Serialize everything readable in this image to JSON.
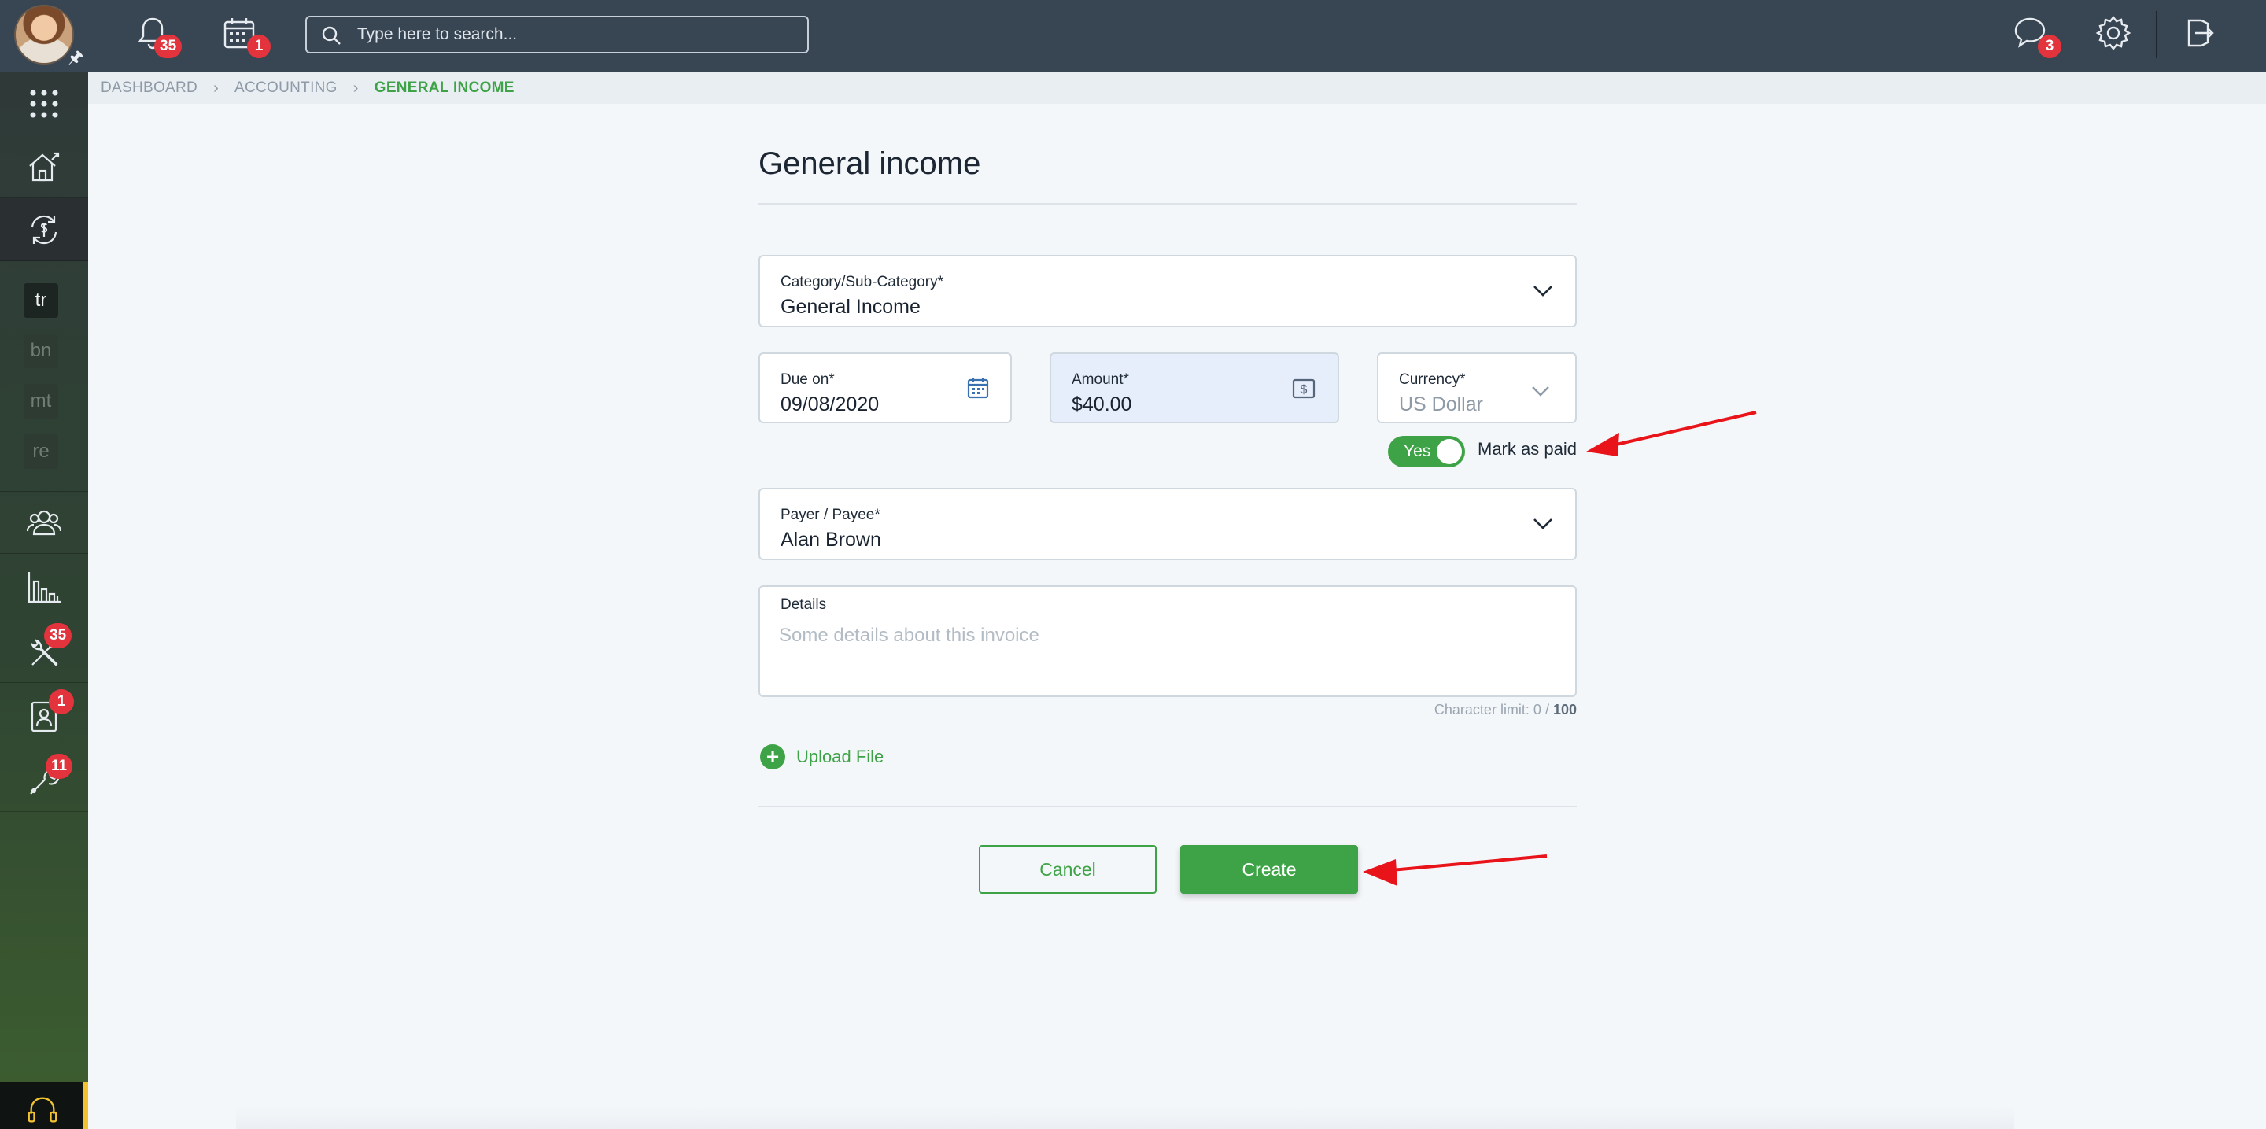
{
  "topbar": {
    "notifications_count": "35",
    "calendar_count": "1",
    "messages_count": "3",
    "search": {
      "placeholder": "Type here to search..."
    }
  },
  "sidebar": {
    "mini_items": [
      "tr",
      "bn",
      "mt",
      "re"
    ],
    "badges": {
      "tools": "35",
      "contacts": "1",
      "maintenance": "11"
    }
  },
  "breadcrumb": [
    "DASHBOARD",
    "ACCOUNTING",
    "GENERAL INCOME"
  ],
  "form": {
    "title": "General income",
    "category": {
      "label": "Category/Sub-Category*",
      "value": "General Income"
    },
    "due_on": {
      "label": "Due on*",
      "value": "09/08/2020"
    },
    "amount": {
      "label": "Amount*",
      "value": "$40.00"
    },
    "currency": {
      "label": "Currency*",
      "value": "US Dollar"
    },
    "mark_paid": {
      "toggle_label": "Yes",
      "label": "Mark as paid",
      "checked": true
    },
    "payer": {
      "label": "Payer / Payee*",
      "value": "Alan Brown"
    },
    "details": {
      "label": "Details",
      "placeholder": "Some details about this invoice"
    },
    "char_limit": {
      "prefix": "Character limit: 0 / ",
      "max": "100"
    },
    "upload_label": "Upload File",
    "cancel_label": "Cancel",
    "create_label": "Create"
  },
  "colors": {
    "topbar": "#384552",
    "accent": "#3ea346",
    "badge": "#e3343d",
    "annotation": "#e8141a"
  }
}
